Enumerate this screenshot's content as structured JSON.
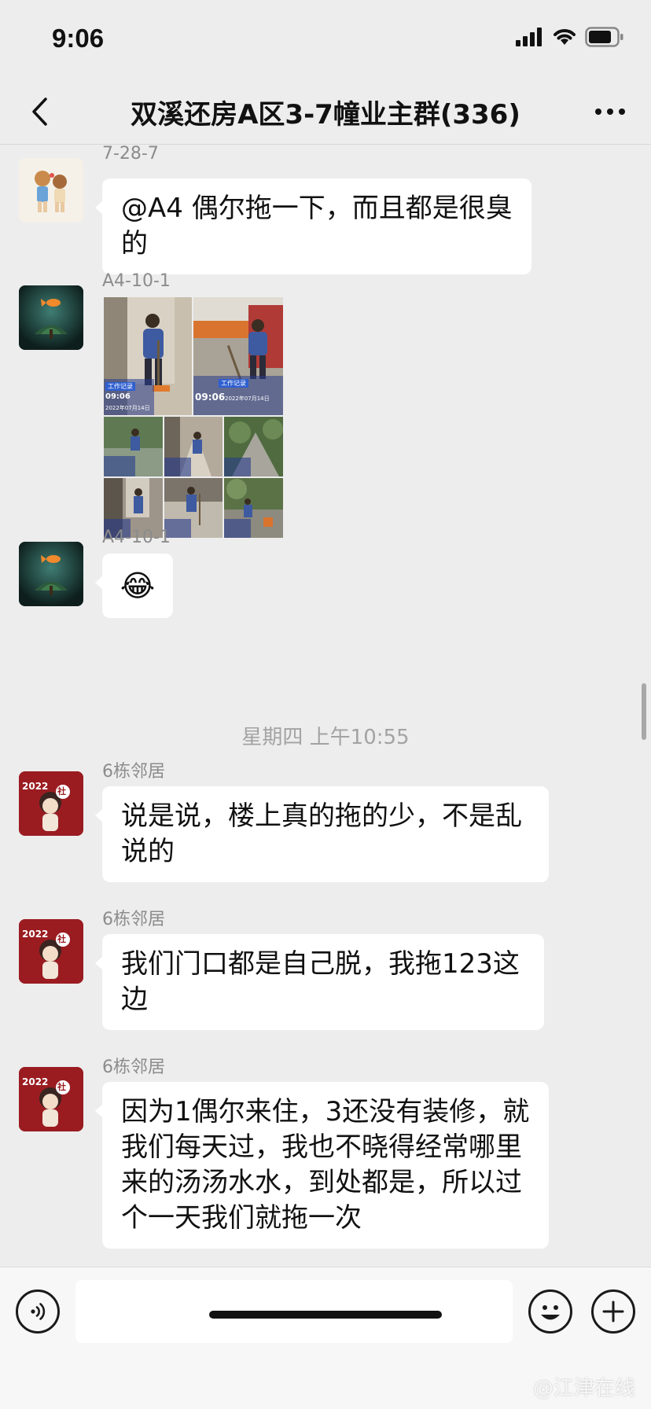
{
  "status_bar": {
    "time": "9:06"
  },
  "header": {
    "title": "双溪还房A区3-7幢业主群(336)"
  },
  "messages": [
    {
      "sender": "7-28-7",
      "text": "@A4 偶尔拖一下，而且都是很臭的"
    },
    {
      "sender": "A4-10-1",
      "type": "image-collage"
    },
    {
      "sender": "A4-10-1",
      "emoji": "😂"
    },
    {
      "sender": "6栋邻居",
      "text": "说是说，楼上真的拖的少，不是乱说的"
    },
    {
      "sender": "6栋邻居",
      "text": "我们门口都是自己脱，我拖123这边"
    },
    {
      "sender": "6栋邻居",
      "text": "因为1偶尔来住，3还没有装修，就我们每天过，我也不晓得经常哪里来的汤汤水水，到处都是，所以过个一天我们就拖一次"
    }
  ],
  "image_collage": {
    "labels": [
      "工作记录",
      "工作记录"
    ],
    "times": [
      "09:06",
      "09:06"
    ],
    "dates": [
      "2022年07月14日",
      "2022年07月14日"
    ]
  },
  "time_divider": "星期四 上午10:55",
  "avatar_badge": {
    "year": "2022",
    "glyph": "社"
  },
  "watermark": "@江津在线",
  "icons": [
    "signal-icon",
    "wifi-icon",
    "battery-icon",
    "back-icon",
    "more-icon",
    "voice-icon",
    "emoji-icon",
    "plus-icon"
  ],
  "colors": {
    "background": "#ededed",
    "bubble": "#ffffff",
    "meta_text": "#8c8c8c"
  }
}
